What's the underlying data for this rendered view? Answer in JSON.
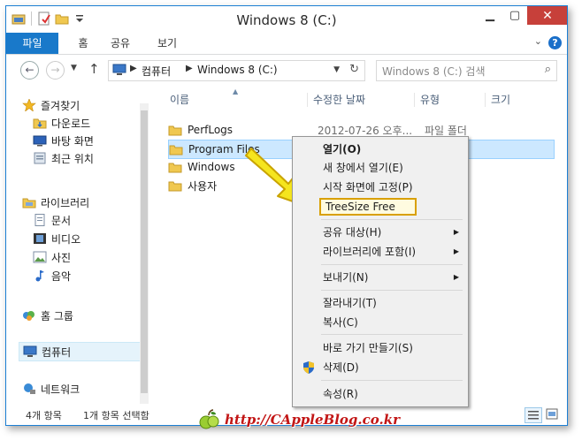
{
  "window": {
    "title": "Windows 8 (C:)"
  },
  "ribbon": {
    "tabs": [
      "파일",
      "홈",
      "공유",
      "보기"
    ]
  },
  "address": {
    "crumbs": [
      "컴퓨터",
      "Windows 8 (C:)"
    ]
  },
  "search": {
    "placeholder": "Windows 8 (C:) 검색"
  },
  "nav": {
    "favorites": {
      "label": "즐겨찾기",
      "items": [
        "다운로드",
        "바탕 화면",
        "최근 위치"
      ]
    },
    "libraries": {
      "label": "라이브러리",
      "items": [
        "문서",
        "비디오",
        "사진",
        "음악"
      ]
    },
    "homegroup": "홈 그룹",
    "computer": "컴퓨터",
    "network": "네트워크"
  },
  "columns": {
    "name": "이름",
    "modified": "수정한 날짜",
    "type": "유형",
    "size": "크기"
  },
  "files": [
    {
      "name": "PerfLogs",
      "date": "2012-07-26 오후...",
      "type": "파일 폴더"
    },
    {
      "name": "Program Files",
      "date": "",
      "type": ""
    },
    {
      "name": "Windows",
      "date": "",
      "type": ""
    },
    {
      "name": "사용자",
      "date": "",
      "type": ""
    }
  ],
  "context_menu": {
    "open": "열기(O)",
    "open_new_window": "새 창에서 열기(E)",
    "pin_start": "시작 화면에 고정(P)",
    "treesize": "TreeSize Free",
    "share_with": "공유 대상(H)",
    "include_library": "라이브러리에 포함(I)",
    "send_to": "보내기(N)",
    "cut": "잘라내기(T)",
    "copy": "복사(C)",
    "create_shortcut": "바로 가기 만들기(S)",
    "delete": "삭제(D)",
    "properties": "속성(R)"
  },
  "status": {
    "item_count": "4개 항목",
    "selected": "1개 항목 선택함"
  },
  "watermark": "http://CAppleBlog.co.kr",
  "colors": {
    "accent": "#1979ca",
    "selection": "#cce8ff",
    "close": "#c7403a",
    "highlight_border": "#d9a000",
    "arrow": "#f5e51e"
  }
}
